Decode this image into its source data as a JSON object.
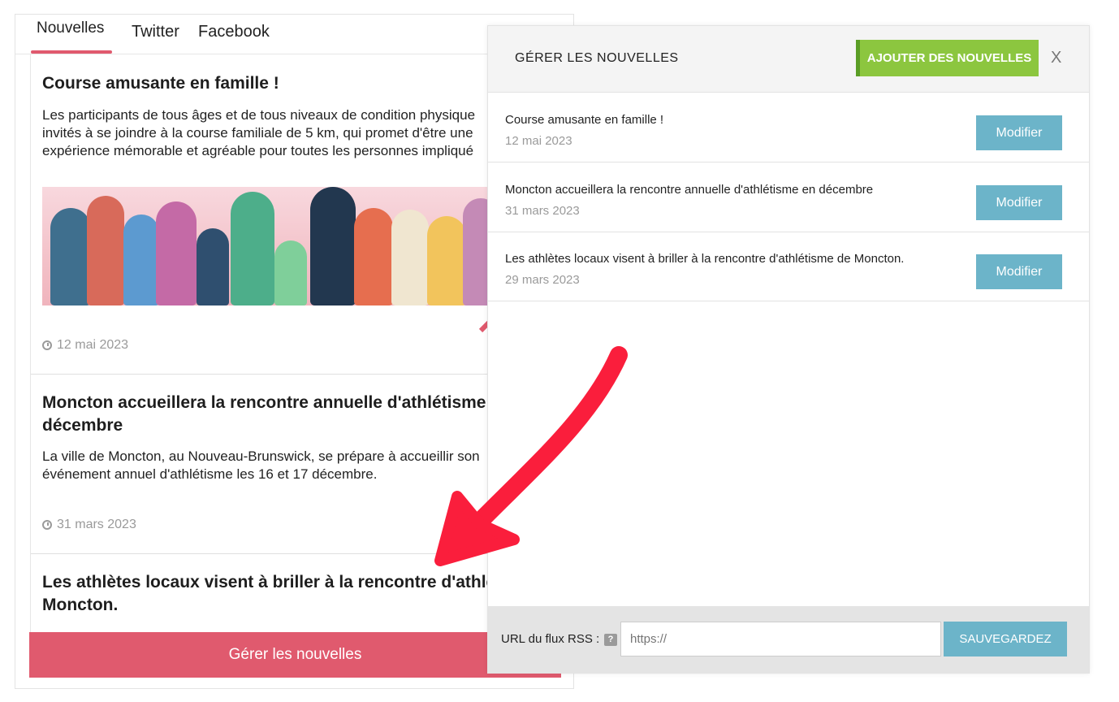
{
  "widget": {
    "tabs": [
      "Nouvelles",
      "Twitter",
      "Facebook"
    ],
    "articles": [
      {
        "title": "Course amusante en famille !",
        "text": [
          "Les participants de tous âges et de tous niveaux de condition physique",
          "invités à se joindre à la course familiale de 5 km, qui promet d'être une",
          "expérience mémorable et agréable pour toutes les personnes impliqué"
        ],
        "date": "12 mai 2023"
      },
      {
        "title": [
          "Moncton accueillera la rencontre annuelle d'athlétisme en",
          "décembre"
        ],
        "text": [
          "La ville de Moncton, au Nouveau-Brunswick, se prépare à accueillir son",
          "événement annuel d'athlétisme les 16 et 17 décembre."
        ],
        "date": "31 mars 2023"
      },
      {
        "title": [
          "Les athlètes locaux visent à briller à la rencontre d'athlétis",
          "Moncton."
        ]
      }
    ],
    "manage_label": "Gérer les nouvelles"
  },
  "panel": {
    "title": "GÉRER LES NOUVELLES",
    "add_label": "AJOUTER DES NOUVELLES",
    "close_label": "X",
    "items": [
      {
        "title": "Course amusante en famille !",
        "date": "12 mai 2023",
        "edit_label": "Modifier"
      },
      {
        "title": "Moncton accueillera la rencontre annuelle d'athlétisme en décembre",
        "date": "31 mars 2023",
        "edit_label": "Modifier"
      },
      {
        "title": "Les athlètes locaux visent à briller à la rencontre d'athlétisme de Moncton.",
        "date": "29 mars 2023",
        "edit_label": "Modifier"
      }
    ],
    "rss": {
      "label": "URL du flux RSS :",
      "help": "?",
      "placeholder": "https://",
      "save_label": "SAUVEGARDEZ"
    }
  },
  "colors": {
    "accent_pink": "#e05a6e",
    "green": "#8cc63f",
    "teal": "#6cb4c9",
    "arrow_red": "#fa1e3c"
  },
  "icons": [
    "clock-icon",
    "pencil-icon",
    "help-icon",
    "close-icon"
  ]
}
